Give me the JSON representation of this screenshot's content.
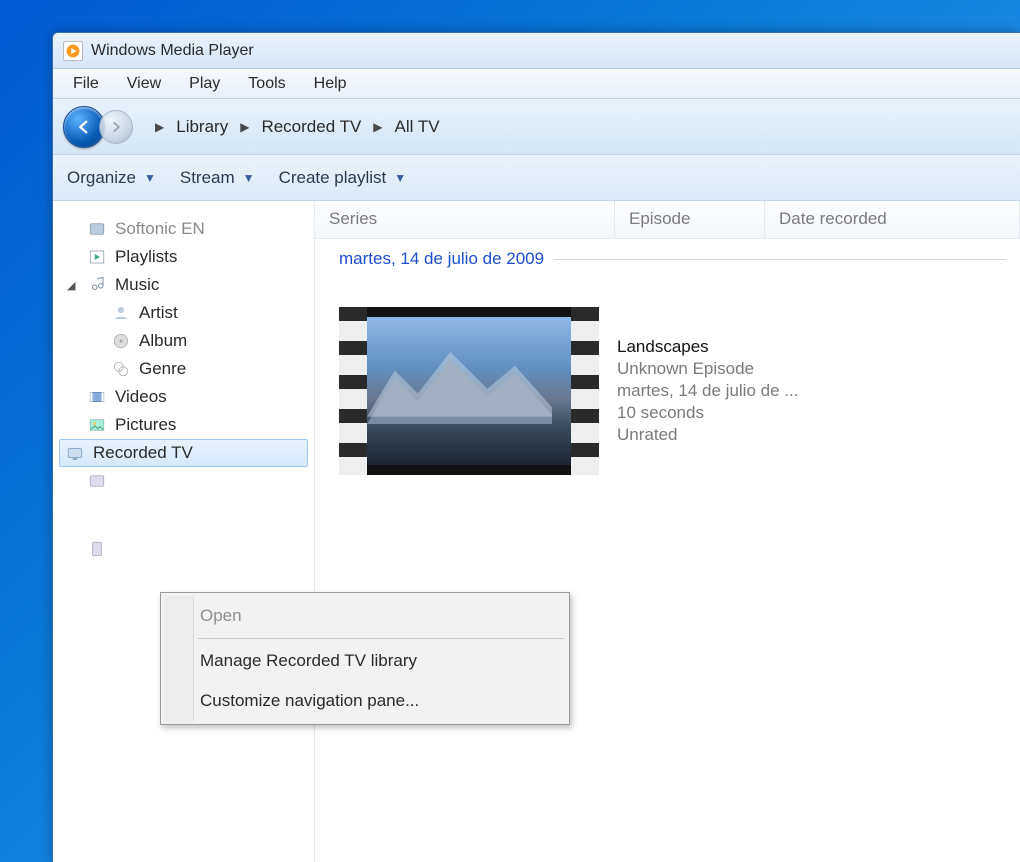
{
  "window": {
    "title": "Windows Media Player"
  },
  "menus": {
    "file": "File",
    "view": "View",
    "play": "Play",
    "tools": "Tools",
    "help": "Help"
  },
  "breadcrumb": {
    "a": "Library",
    "b": "Recorded TV",
    "c": "All TV"
  },
  "toolbar": {
    "organize": "Organize",
    "stream": "Stream",
    "create_playlist": "Create playlist"
  },
  "sidebar": {
    "softonic": "Softonic EN",
    "playlists": "Playlists",
    "music": "Music",
    "artist": "Artist",
    "album": "Album",
    "genre": "Genre",
    "videos": "Videos",
    "pictures": "Pictures",
    "recorded_tv": "Recorded TV"
  },
  "columns": {
    "series": "Series",
    "episode": "Episode",
    "date": "Date recorded"
  },
  "group": {
    "label": "martes, 14 de julio de 2009"
  },
  "item": {
    "title": "Landscapes",
    "episode": "Unknown Episode",
    "date": "martes, 14 de julio de ...",
    "duration": "10 seconds",
    "rating": "Unrated"
  },
  "context_menu": {
    "open": "Open",
    "manage": "Manage Recorded TV library",
    "customize": "Customize navigation pane..."
  }
}
